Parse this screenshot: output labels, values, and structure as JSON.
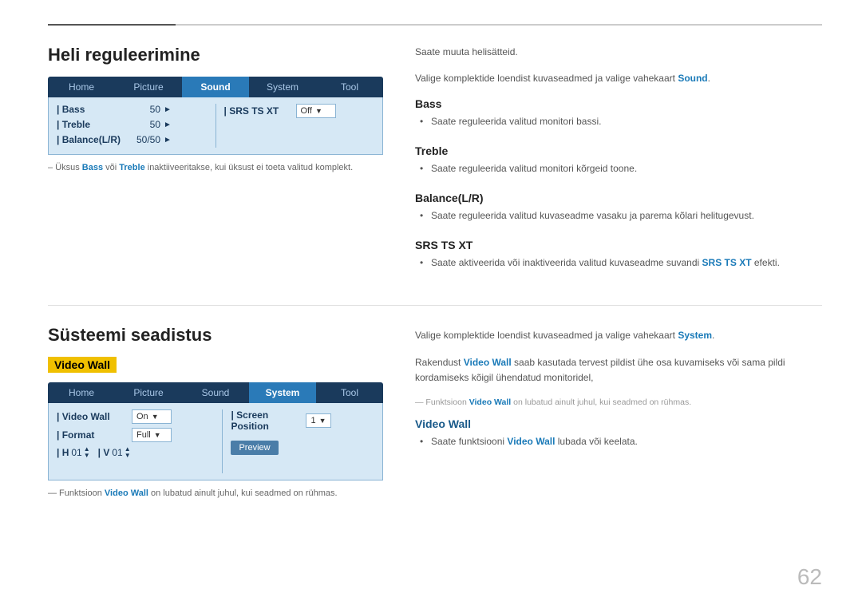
{
  "page": {
    "number": "62"
  },
  "top_rule": true,
  "section1": {
    "title": "Heli reguleerimine",
    "menu": {
      "items": [
        {
          "label": "Home",
          "active": false
        },
        {
          "label": "Picture",
          "active": false
        },
        {
          "label": "Sound",
          "active": true
        },
        {
          "label": "System",
          "active": false
        },
        {
          "label": "Tool",
          "active": false
        }
      ]
    },
    "panel_rows": [
      {
        "label": "| Bass",
        "value": "50",
        "has_arrow": true
      },
      {
        "label": "| Treble",
        "value": "50",
        "has_arrow": true
      },
      {
        "label": "| Balance(L/R)",
        "value": "50/50",
        "has_arrow": true
      }
    ],
    "panel_right_rows": [
      {
        "label": "| SRS TS XT",
        "value": "Off",
        "has_dropdown": true
      }
    ],
    "note": "– Üksus Bass või Treble inaktiiveeritakse, kui üksust ei toeta valitud komplekt."
  },
  "section1_right": {
    "intro": "Saate muuta helisätteid.",
    "intro2": "Valige komplektide loendist kuvaseadmed ja valige vahekaart Sound.",
    "intro2_link": "Sound",
    "subsections": [
      {
        "heading": "Bass",
        "bullet": "Saate reguleerida valitud monitori bassi."
      },
      {
        "heading": "Treble",
        "bullet": "Saate reguleerida valitud monitori kõrgeid toone."
      },
      {
        "heading": "Balance(L/R)",
        "bullet": "Saate reguleerida valitud kuvaseadme vasaku ja parema kõlari helitugevust."
      },
      {
        "heading": "SRS TS XT",
        "bullet": "Saate aktiveerida või inaktiveerida valitud kuvaseadme suvandi SRS TS XT efekti.",
        "bullet_link": "SRS TS XT"
      }
    ]
  },
  "section2": {
    "title": "Süsteemi seadistus",
    "highlight": "Video Wall",
    "menu": {
      "items": [
        {
          "label": "Home",
          "active": false
        },
        {
          "label": "Picture",
          "active": false
        },
        {
          "label": "Sound",
          "active": false
        },
        {
          "label": "System",
          "active": true
        },
        {
          "label": "Tool",
          "active": false
        }
      ]
    },
    "panel_rows_left": [
      {
        "label": "| Video Wall",
        "value": "On",
        "has_dropdown": true
      },
      {
        "label": "| Format",
        "value": "Full",
        "has_dropdown": true
      },
      {
        "label": "| H",
        "value": "01",
        "has_spinner": true,
        "label2": "| V",
        "value2": "01",
        "has_spinner2": true
      }
    ],
    "panel_rows_right": [
      {
        "label": "| Screen Position",
        "value": "1",
        "has_dropdown": true
      },
      {
        "label": "",
        "value": "",
        "has_preview": true
      }
    ],
    "note": "– Funktsioon Video Wall on lubatud ainult juhul, kui seadmed on rühmas.",
    "note_link": "Video Wall"
  },
  "section2_right": {
    "intro": "Valige komplektide loendist kuvaseadmed ja valige vahekaart System.",
    "intro_link": "System",
    "intro2": "Rakendust Video Wall saab kasutada tervest pildist ühe osa kuvamiseks või sama pildi kordamiseks kõigil ühendatud monitoridel,",
    "intro2_link": "Video Wall",
    "note": "— Funktsioon Video Wall on lubatud ainult juhul, kui seadmed on rühmas.",
    "note_link": "Video Wall",
    "subsections": [
      {
        "heading": "Video Wall",
        "bullet": "Saate funktsiooni Video Wall lubada või keelata.",
        "bullet_link": "Video Wall"
      }
    ]
  }
}
